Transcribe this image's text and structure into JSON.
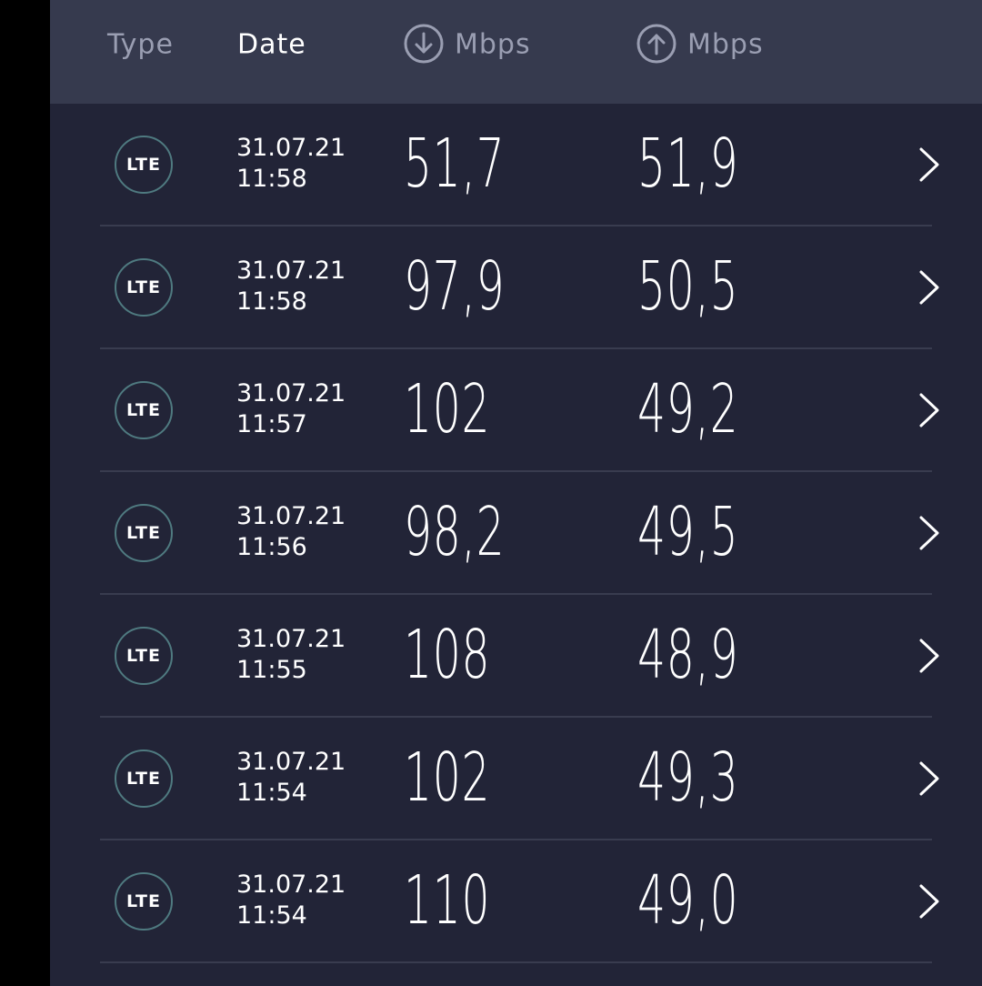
{
  "header": {
    "type_label": "Type",
    "date_label": "Date",
    "download_label": "Mbps",
    "upload_label": "Mbps",
    "download_icon": "arrow-down-circle-icon",
    "upload_icon": "arrow-up-circle-icon"
  },
  "rows": [
    {
      "type": "LTE",
      "date": "31.07.21",
      "time": "11:58",
      "download": "51,7",
      "upload": "51,9"
    },
    {
      "type": "LTE",
      "date": "31.07.21",
      "time": "11:58",
      "download": "97,9",
      "upload": "50,5"
    },
    {
      "type": "LTE",
      "date": "31.07.21",
      "time": "11:57",
      "download": "102",
      "upload": "49,2"
    },
    {
      "type": "LTE",
      "date": "31.07.21",
      "time": "11:56",
      "download": "98,2",
      "upload": "49,5"
    },
    {
      "type": "LTE",
      "date": "31.07.21",
      "time": "11:55",
      "download": "108",
      "upload": "48,9"
    },
    {
      "type": "LTE",
      "date": "31.07.21",
      "time": "11:54",
      "download": "102",
      "upload": "49,3"
    },
    {
      "type": "LTE",
      "date": "31.07.21",
      "time": "11:54",
      "download": "110",
      "upload": "49,0"
    }
  ],
  "colors": {
    "background": "#222437",
    "header_bg": "#363a4e",
    "muted_text": "#9a9eb2",
    "badge_ring": "#4f7a80",
    "separator": "#393c4f"
  }
}
